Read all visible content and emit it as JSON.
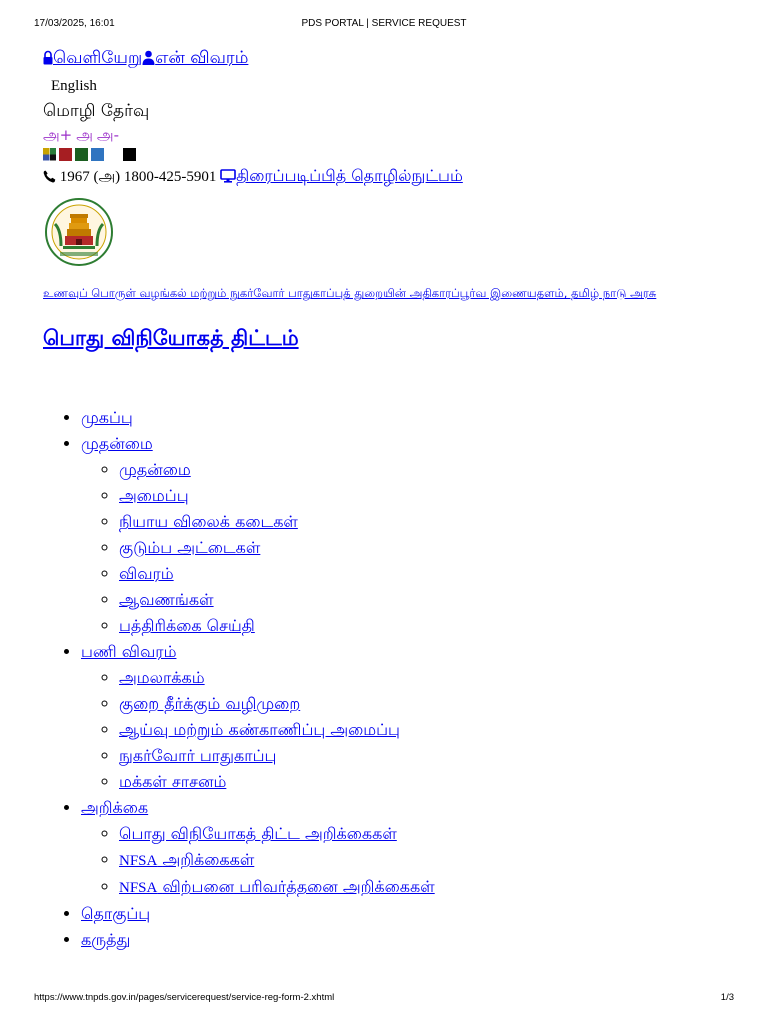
{
  "print": {
    "datetime": "17/03/2025, 16:01",
    "title": "PDS PORTAL | SERVICE REQUEST",
    "url": "https://www.tnpds.gov.in/pages/servicerequest/service-reg-form-2.xhtml",
    "page": "1/3"
  },
  "top_links": {
    "logout": "வெளியேறு",
    "my_profile": "என் விவரம்"
  },
  "language": {
    "english": "English",
    "choose_label": "மொழி தேர்வு"
  },
  "font_size": {
    "increase": "அ+",
    "normal": "அ",
    "decrease": "அ-"
  },
  "theme_colors": [
    "multi",
    "#a61e22",
    "#1b5e20",
    "#2f74c0",
    "#ffffff",
    "#000000"
  ],
  "contact": {
    "helpline": "1967 (அ) 1800-425-5901",
    "screen_reader": "திரைப்படிப்பித் தொழில்நுட்பம்"
  },
  "department_link": "உணவுப் பொருள் வழங்கல் மற்றும் நுகர்வோர் பாதுகாப்புத் துறையின் அதிகாரப்பூர்வ இணையதளம், தமிழ் நாடு அரசு",
  "site_title": "பொது விநியோகத் திட்டம்",
  "nav": [
    {
      "label": "முகப்பு"
    },
    {
      "label": "முதன்மை",
      "children": [
        "முதன்மை",
        "அமைப்பு",
        "நியாய விலைக் கடைகள்",
        "குடும்ப அட்டைகள்",
        "விவரம்",
        "ஆவணங்கள்",
        "பத்திரிக்கை செய்தி"
      ]
    },
    {
      "label": "பணி விவரம்",
      "children": [
        "அமலாக்கம்",
        "குறை தீர்க்கும் வழிமுறை",
        "ஆய்வு மற்றும் கண்காணிப்பு அமைப்பு",
        "நுகர்வோர் பாதுகாப்பு",
        "மக்கள் சாசனம்"
      ]
    },
    {
      "label": "அறிக்கை",
      "children_plain": [
        "பொது விநியோகத் திட்ட அறிக்கைகள்"
      ],
      "nfsa_prefix": "NFSA",
      "nfsa_children": [
        "அறிக்கைகள்",
        "விற்பனை பரிவர்த்தனை அறிக்கைகள்"
      ]
    },
    {
      "label": "தொகுப்பு"
    },
    {
      "label": "கருத்து"
    }
  ]
}
